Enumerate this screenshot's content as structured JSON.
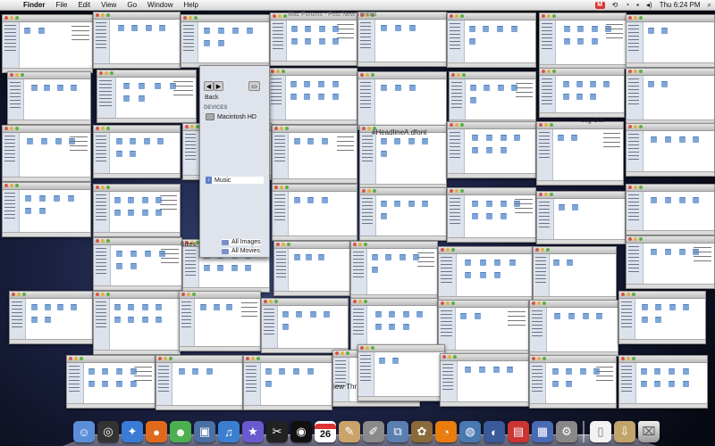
{
  "menubar": {
    "apple_glyph": "",
    "app": "Finder",
    "items": [
      "File",
      "Edit",
      "View",
      "Go",
      "Window",
      "Help"
    ],
    "clock": "Thu 6:24 PM",
    "mail_icon": "M",
    "status_icons": [
      "mail-icon",
      "time-machine-icon",
      "wifi-icon",
      "flag-icon",
      "volume-icon",
      "spotlight-icon"
    ]
  },
  "windows": {
    "title": "Mac Forums - Post New Thread",
    "logout": "Log Out",
    "font_file": "#HeadlineA.dfont",
    "sizes_label": "Sizes",
    "view_thread": "iew Thr"
  },
  "finder_fragment": {
    "back": "Back",
    "devices_header": "DEVICES",
    "disk": "Macintosh HD",
    "music": "Music",
    "all_images": "All Images",
    "all_movies": "All Movies"
  },
  "dock": {
    "apps": [
      "finder-icon",
      "dashboard-icon",
      "safari-icon",
      "firefox-icon",
      "ichat-icon",
      "iphoto-icon",
      "itunes-icon",
      "imovie-icon",
      "final-cut-icon",
      "dvd-player-icon",
      "ical-icon",
      "text-edit-icon",
      "script-editor-icon",
      "preview-icon",
      "gimp-icon",
      "blender-icon",
      "google-earth-icon",
      "coda-icon",
      "photo-booth-icon",
      "keynote-icon",
      "system-preferences-icon",
      "document-icon",
      "downloads-icon",
      "trash-icon"
    ],
    "ical_date": "26"
  },
  "colors": {
    "accent": "#3b6fd6",
    "menubar": "#e8e8e8",
    "desktop": "#1a2040"
  }
}
